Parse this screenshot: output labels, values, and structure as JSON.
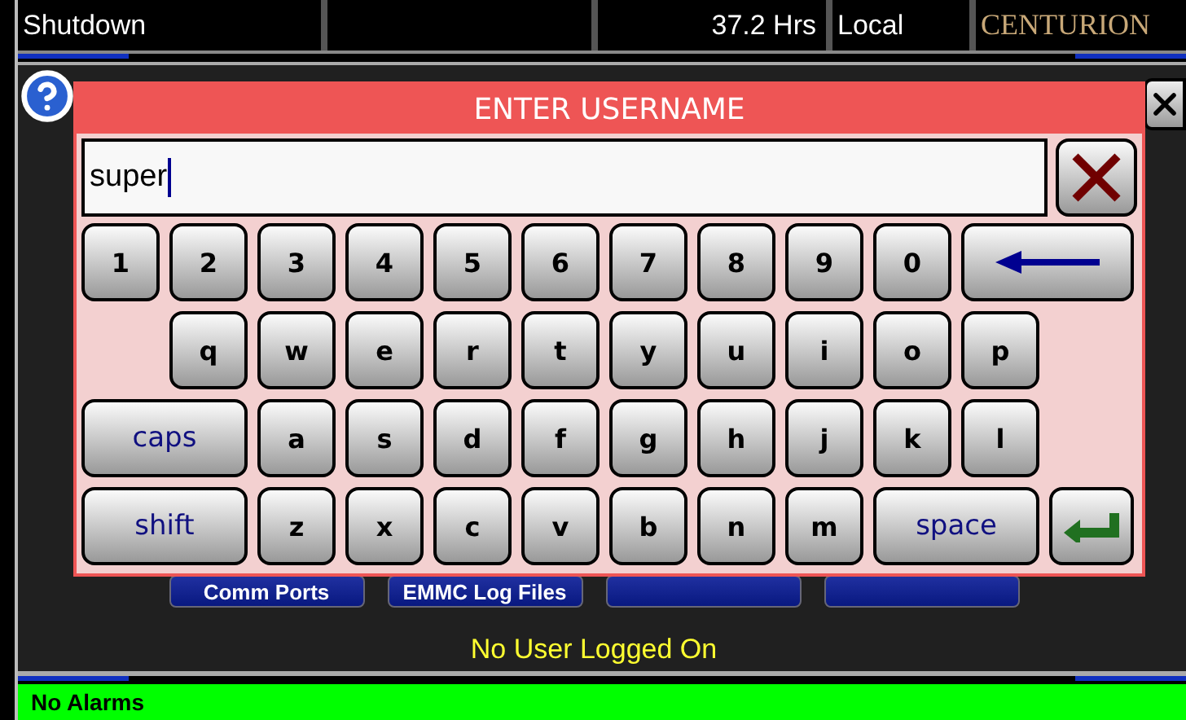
{
  "status_bar": {
    "cells": [
      "Shutdown",
      "",
      "37.2 Hrs",
      "Local"
    ],
    "logo": "CENTURION"
  },
  "panel": {
    "buttons": [
      {
        "kind": "labeled",
        "label": "Comm Ports"
      },
      {
        "kind": "labeled",
        "label": "EMMC Log Files"
      },
      {
        "kind": "blank"
      },
      {
        "kind": "blank"
      }
    ],
    "login_status": "No User Logged On"
  },
  "dialog": {
    "title": "ENTER USERNAME",
    "value": "super",
    "keys": [
      {
        "kind": "char",
        "label": "1"
      },
      {
        "kind": "char",
        "label": "2"
      },
      {
        "kind": "char",
        "label": "3"
      },
      {
        "kind": "char",
        "label": "4"
      },
      {
        "kind": "char",
        "label": "5"
      },
      {
        "kind": "char",
        "label": "6"
      },
      {
        "kind": "char",
        "label": "7"
      },
      {
        "kind": "char",
        "label": "8"
      },
      {
        "kind": "char",
        "label": "9"
      },
      {
        "kind": "char",
        "label": "0"
      },
      {
        "kind": "backspace"
      },
      {
        "kind": "char",
        "label": "q"
      },
      {
        "kind": "char",
        "label": "w"
      },
      {
        "kind": "char",
        "label": "e"
      },
      {
        "kind": "char",
        "label": "r"
      },
      {
        "kind": "char",
        "label": "t"
      },
      {
        "kind": "char",
        "label": "y"
      },
      {
        "kind": "char",
        "label": "u"
      },
      {
        "kind": "char",
        "label": "i"
      },
      {
        "kind": "char",
        "label": "o"
      },
      {
        "kind": "char",
        "label": "p"
      },
      {
        "kind": "function",
        "label": "caps"
      },
      {
        "kind": "char",
        "label": "a"
      },
      {
        "kind": "char",
        "label": "s"
      },
      {
        "kind": "char",
        "label": "d"
      },
      {
        "kind": "char",
        "label": "f"
      },
      {
        "kind": "char",
        "label": "g"
      },
      {
        "kind": "char",
        "label": "h"
      },
      {
        "kind": "char",
        "label": "j"
      },
      {
        "kind": "char",
        "label": "k"
      },
      {
        "kind": "char",
        "label": "l"
      },
      {
        "kind": "function",
        "label": "shift"
      },
      {
        "kind": "char",
        "label": "z"
      },
      {
        "kind": "char",
        "label": "x"
      },
      {
        "kind": "char",
        "label": "c"
      },
      {
        "kind": "char",
        "label": "v"
      },
      {
        "kind": "char",
        "label": "b"
      },
      {
        "kind": "char",
        "label": "n"
      },
      {
        "kind": "char",
        "label": "m"
      },
      {
        "kind": "function",
        "label": "space"
      },
      {
        "kind": "enter"
      }
    ]
  },
  "alarm_bar": {
    "text": "No Alarms"
  }
}
